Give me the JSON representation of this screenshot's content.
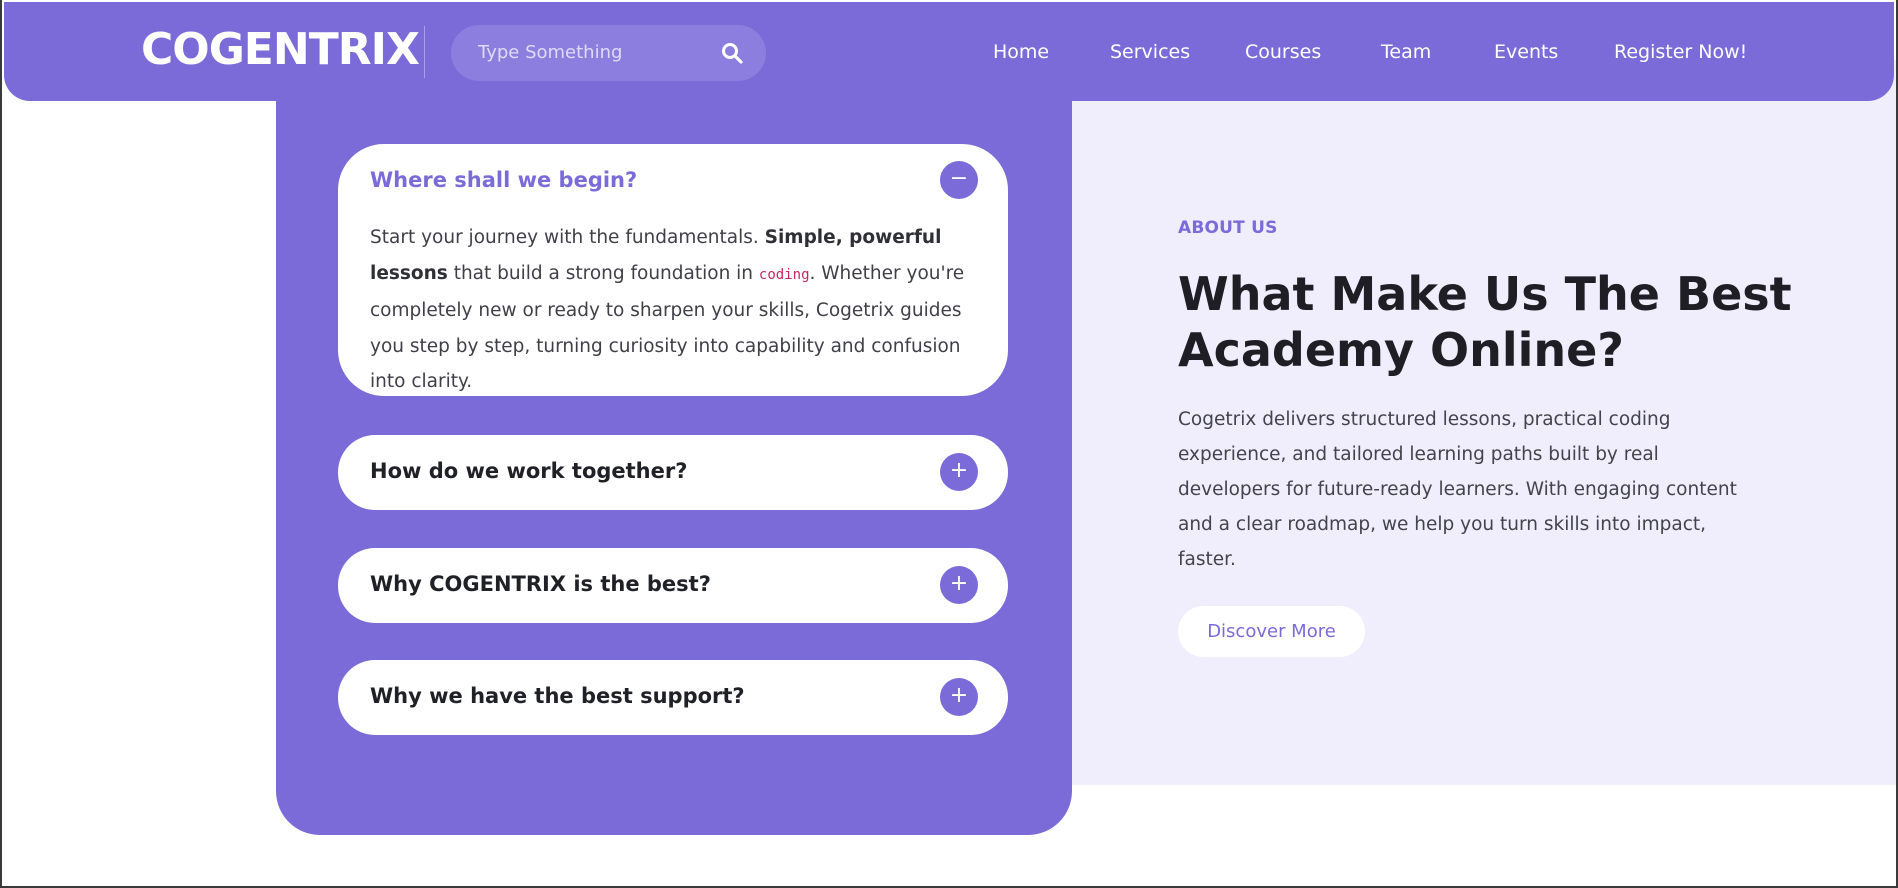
{
  "header": {
    "logo": "COGENTRIX",
    "search": {
      "placeholder": "Type Something",
      "icon": "search-icon"
    },
    "nav": [
      "Home",
      "Services",
      "Courses",
      "Team",
      "Events",
      "Register Now!"
    ]
  },
  "faq": [
    {
      "question": "Where shall we begin?",
      "expanded": true,
      "toggle": "−",
      "answer": {
        "text_1": "Start your journey with the fundamentals. ",
        "bold": "Simple, powerful lessons",
        "text_2": " that build a strong foundation in ",
        "code": "coding",
        "text_3": ". Whether you're completely new or ready to sharpen your skills, Cogetrix guides you step by step, turning curiosity into capability and confusion into clarity."
      }
    },
    {
      "question": "How do we work together?",
      "expanded": false,
      "toggle": "+"
    },
    {
      "question": "Why COGENTRIX is the best?",
      "expanded": false,
      "toggle": "+"
    },
    {
      "question": "Why we have the best support?",
      "expanded": false,
      "toggle": "+"
    }
  ],
  "about": {
    "eyebrow": "ABOUT US",
    "title_line1": "What Make Us The Best",
    "title_line2": "Academy Online?",
    "text": "Cogetrix delivers structured lessons, practical coding experience, and tailored learning paths built by real developers for future-ready learners. With engaging content and a clear roadmap, we help you turn skills into impact, faster.",
    "button": "Discover More"
  },
  "colors": {
    "accent": "#7a6bd8",
    "about_bg": "#f0eefc",
    "code": "#c7265e"
  }
}
